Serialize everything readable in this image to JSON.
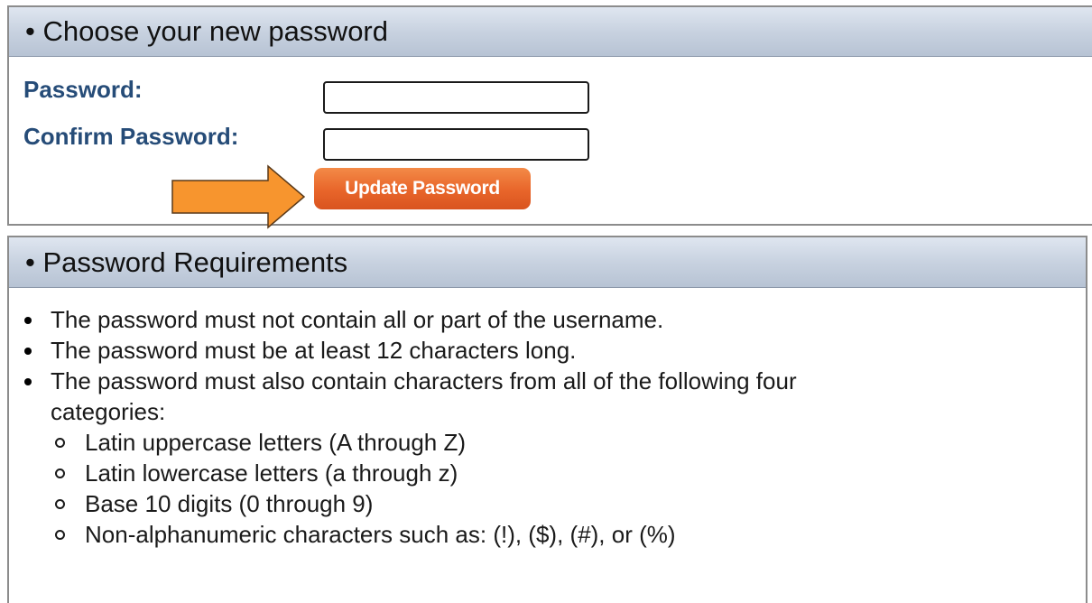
{
  "choose_panel": {
    "title": "• Choose your new password",
    "password_label": "Password:",
    "confirm_label": "Confirm Password:",
    "password_value": "",
    "confirm_value": "",
    "update_button_label": "Update Password"
  },
  "requirements_panel": {
    "title": "• Password Requirements",
    "items": [
      "The password must not contain all or part of the username.",
      "The password must be at least 12 characters long.",
      "The password must also contain characters from all of the following four categories:"
    ],
    "categories": [
      "Latin uppercase letters (A through Z)",
      "Latin lowercase letters (a through z)",
      "Base 10 digits (0 through 9)",
      "Non-alphanumeric characters such as: (!), ($), (#), or (%)"
    ]
  },
  "icons": {
    "arrow": "right-arrow-icon",
    "bullet": "bullet-dot-icon",
    "sub_bullet": "hollow-circle-bullet-icon"
  },
  "colors": {
    "label_blue": "#264c78",
    "button_orange": "#e8652a",
    "arrow_orange": "#f7952e",
    "header_gradient": "#c8d2e0"
  }
}
